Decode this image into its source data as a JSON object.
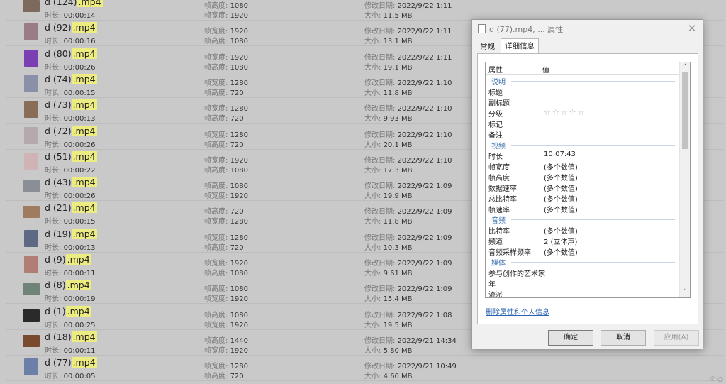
{
  "labels": {
    "duration": "时长:",
    "height": "帧高度:",
    "width": "帧宽度:",
    "modified": "修改日期:",
    "size": "大小:"
  },
  "files": [
    {
      "base": "d (124)",
      "ext": ".mp4",
      "duration": "00:00:14",
      "l1": "帧高度:",
      "v1": "1080",
      "l2": "帧宽度:",
      "v2": "1920",
      "modified": "2022/9/22 1:11",
      "size": "11.5 MB",
      "thumb": "land",
      "color": "#7d6a5c"
    },
    {
      "base": "d (92)",
      "ext": ".mp4",
      "duration": "00:00:16",
      "l1": "帧宽度:",
      "v1": "1920",
      "l2": "帧高度:",
      "v2": "1080",
      "modified": "2022/9/22 1:11",
      "size": "13.1 MB",
      "thumb": "port",
      "color": "#9a7d84"
    },
    {
      "base": "d (80)",
      "ext": ".mp4",
      "duration": "00:00:26",
      "l1": "帧宽度:",
      "v1": "1920",
      "l2": "帧高度:",
      "v2": "1080",
      "modified": "2022/9/22 1:11",
      "size": "19.1 MB",
      "thumb": "port",
      "color": "#7a3fb0"
    },
    {
      "base": "d (74)",
      "ext": ".mp4",
      "duration": "00:00:15",
      "l1": "帧宽度:",
      "v1": "1280",
      "l2": "帧高度:",
      "v2": "720",
      "modified": "2022/9/22 1:10",
      "size": "11.8 MB",
      "thumb": "port",
      "color": "#8c8fa8"
    },
    {
      "base": "d (73)",
      "ext": ".mp4",
      "duration": "00:00:13",
      "l1": "帧宽度:",
      "v1": "1280",
      "l2": "帧高度:",
      "v2": "720",
      "modified": "2022/9/22 1:10",
      "size": "9.93 MB",
      "thumb": "port",
      "color": "#8a6d57"
    },
    {
      "base": "d (72)",
      "ext": ".mp4",
      "duration": "00:00:26",
      "l1": "帧宽度:",
      "v1": "1280",
      "l2": "帧高度:",
      "v2": "720",
      "modified": "2022/9/22 1:10",
      "size": "20.1 MB",
      "thumb": "port",
      "color": "#b6a9ad"
    },
    {
      "base": "d (51)",
      "ext": ".mp4",
      "duration": "00:00:22",
      "l1": "帧宽度:",
      "v1": "1920",
      "l2": "帧高度:",
      "v2": "1080",
      "modified": "2022/9/22 1:10",
      "size": "17.3 MB",
      "thumb": "port",
      "color": "#d0b3b4"
    },
    {
      "base": "d (43)",
      "ext": ".mp4",
      "duration": "00:00:26",
      "l1": "帧高度:",
      "v1": "1080",
      "l2": "帧宽度:",
      "v2": "1920",
      "modified": "2022/9/22 1:09",
      "size": "19.9 MB",
      "thumb": "land",
      "color": "#8a8f95"
    },
    {
      "base": "d (21)",
      "ext": ".mp4",
      "duration": "00:00:15",
      "l1": "帧高度:",
      "v1": "720",
      "l2": "帧宽度:",
      "v2": "1280",
      "modified": "2022/9/22 1:09",
      "size": "11.8 MB",
      "thumb": "land",
      "color": "#a07c5e"
    },
    {
      "base": "d (19)",
      "ext": ".mp4",
      "duration": "00:00:13",
      "l1": "帧宽度:",
      "v1": "1280",
      "l2": "帧高度:",
      "v2": "720",
      "modified": "2022/9/22 1:09",
      "size": "10.3 MB",
      "thumb": "port",
      "color": "#5e6a84"
    },
    {
      "base": "d (9)",
      "ext": ".mp4",
      "duration": "00:00:11",
      "l1": "帧宽度:",
      "v1": "1920",
      "l2": "帧高度:",
      "v2": "1080",
      "modified": "2022/9/22 1:09",
      "size": "9.61 MB",
      "thumb": "port",
      "color": "#b07e75"
    },
    {
      "base": "d (8)",
      "ext": ".mp4",
      "duration": "00:00:19",
      "l1": "帧高度:",
      "v1": "1080",
      "l2": "帧宽度:",
      "v2": "1920",
      "modified": "2022/9/22 1:09",
      "size": "15.4 MB",
      "thumb": "land",
      "color": "#6f8378"
    },
    {
      "base": "d (1)",
      "ext": ".mp4",
      "duration": "00:00:25",
      "l1": "帧高度:",
      "v1": "1080",
      "l2": "帧宽度:",
      "v2": "1920",
      "modified": "2022/9/22 1:08",
      "size": "19.5 MB",
      "thumb": "land",
      "color": "#2a2a2a"
    },
    {
      "base": "d (18)",
      "ext": ".mp4",
      "duration": "00:00:11",
      "l1": "帧高度:",
      "v1": "1440",
      "l2": "帧宽度:",
      "v2": "1920",
      "modified": "2022/9/21 14:34",
      "size": "5.80 MB",
      "thumb": "land",
      "color": "#7a4a2e"
    },
    {
      "base": "d (77)",
      "ext": ".mp4",
      "duration": "00:00:05",
      "l1": "帧宽度:",
      "v1": "1280",
      "l2": "帧高度:",
      "v2": "720",
      "modified": "2022/9/21 10:49",
      "size": "4.60 MB",
      "thumb": "port",
      "color": "#6b7fa8"
    }
  ],
  "dialog": {
    "title": "d (77).mp4, ... 属性",
    "close": "✕",
    "tabs": [
      "常规",
      "详细信息"
    ],
    "active_tab": "详细信息",
    "columns": {
      "property": "属性",
      "value": "值"
    },
    "sections": [
      {
        "title": "说明",
        "rows": [
          {
            "k": "标题",
            "v": ""
          },
          {
            "k": "副标题",
            "v": ""
          },
          {
            "k": "分级",
            "v": "☆☆☆☆☆",
            "stars": true
          },
          {
            "k": "标记",
            "v": ""
          },
          {
            "k": "备注",
            "v": ""
          }
        ]
      },
      {
        "title": "视频",
        "rows": [
          {
            "k": "时长",
            "v": "10:07:43"
          },
          {
            "k": "帧宽度",
            "v": "(多个数值)"
          },
          {
            "k": "帧高度",
            "v": "(多个数值)"
          },
          {
            "k": "数据速率",
            "v": "(多个数值)"
          },
          {
            "k": "总比特率",
            "v": "(多个数值)"
          },
          {
            "k": "帧速率",
            "v": "(多个数值)"
          }
        ]
      },
      {
        "title": "音频",
        "rows": [
          {
            "k": "比特率",
            "v": "(多个数值)"
          },
          {
            "k": "频道",
            "v": "2 (立体声)"
          },
          {
            "k": "音频采样频率",
            "v": "(多个数值)"
          }
        ]
      },
      {
        "title": "媒体",
        "rows": [
          {
            "k": "参与创作的艺术家",
            "v": ""
          },
          {
            "k": "年",
            "v": ""
          },
          {
            "k": "流派",
            "v": ""
          }
        ]
      }
    ],
    "remove_link": "删除属性和个人信息",
    "buttons": {
      "ok": "确定",
      "cancel": "取消",
      "apply": "应用(A)"
    },
    "scroll_up": "˄",
    "scroll_down": "˅"
  },
  "corner_glyph": "☉ ○"
}
